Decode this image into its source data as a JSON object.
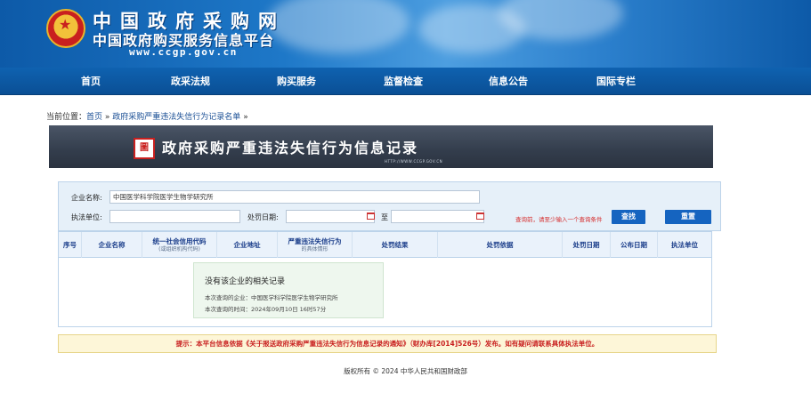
{
  "header": {
    "title_main": "中国政府采购网",
    "title_sub": "中国政府购买服务信息平台",
    "url": "www.ccgp.gov.cn"
  },
  "nav": {
    "items": [
      "首页",
      "政采法规",
      "购买服务",
      "监督检查",
      "信息公告",
      "国际专栏"
    ]
  },
  "breadcrumb": {
    "prefix": "当前位置：",
    "home": "首页",
    "sep": "»",
    "page": "政府采购严重违法失信行为记录名单",
    "tail": "»"
  },
  "title_bar": {
    "seal": "圖",
    "title": "政府采购严重违法失信行为信息记录",
    "url": "HTTP://WWW.CCGP.GOV.CN"
  },
  "search": {
    "company_label": "企业名称:",
    "company_value": "中国医学科学院医学生物学研究所",
    "agency_label": "执法单位:",
    "agency_value": "",
    "date_label": "处罚日期:",
    "date_start": "",
    "date_to": "至",
    "date_end": "",
    "hint": "查询前，请至少输入一个查询条件",
    "search_btn": "查找",
    "reset_btn": "重置"
  },
  "table": {
    "headers": [
      {
        "label": "序号"
      },
      {
        "label": "企业名称"
      },
      {
        "label": "统一社会信用代码",
        "sub": "(或组织机构代码)"
      },
      {
        "label": "企业地址"
      },
      {
        "label": "严重违法失信行为",
        "sub": "的具体情形"
      },
      {
        "label": "处罚结果"
      },
      {
        "label": "处罚依据"
      },
      {
        "label": "处罚日期"
      },
      {
        "label": "公布日期"
      },
      {
        "label": "执法单位"
      }
    ]
  },
  "no_result": {
    "title": "没有该企业的相关记录",
    "company_line": "本次查询的企业：中国医学科学院医学生物学研究所",
    "time_line": "本次查询的时间：2024年09月10日 16时57分"
  },
  "notice": {
    "text": "提示：本平台信息依据《关于报送政府采购严重违法失信行为信息记录的通知》（财办库[2014]526号）发布。如有疑问请联系具体执法单位。"
  },
  "footer": {
    "text": "版权所有 © 2024 中华人民共和国财政部"
  },
  "colors": {
    "nav_blue": "#0a4f95",
    "title_bar": "#333d4c",
    "button_blue": "#1564c0",
    "hint_red": "#d62b2b",
    "notice_bg": "#fdf6d8"
  }
}
